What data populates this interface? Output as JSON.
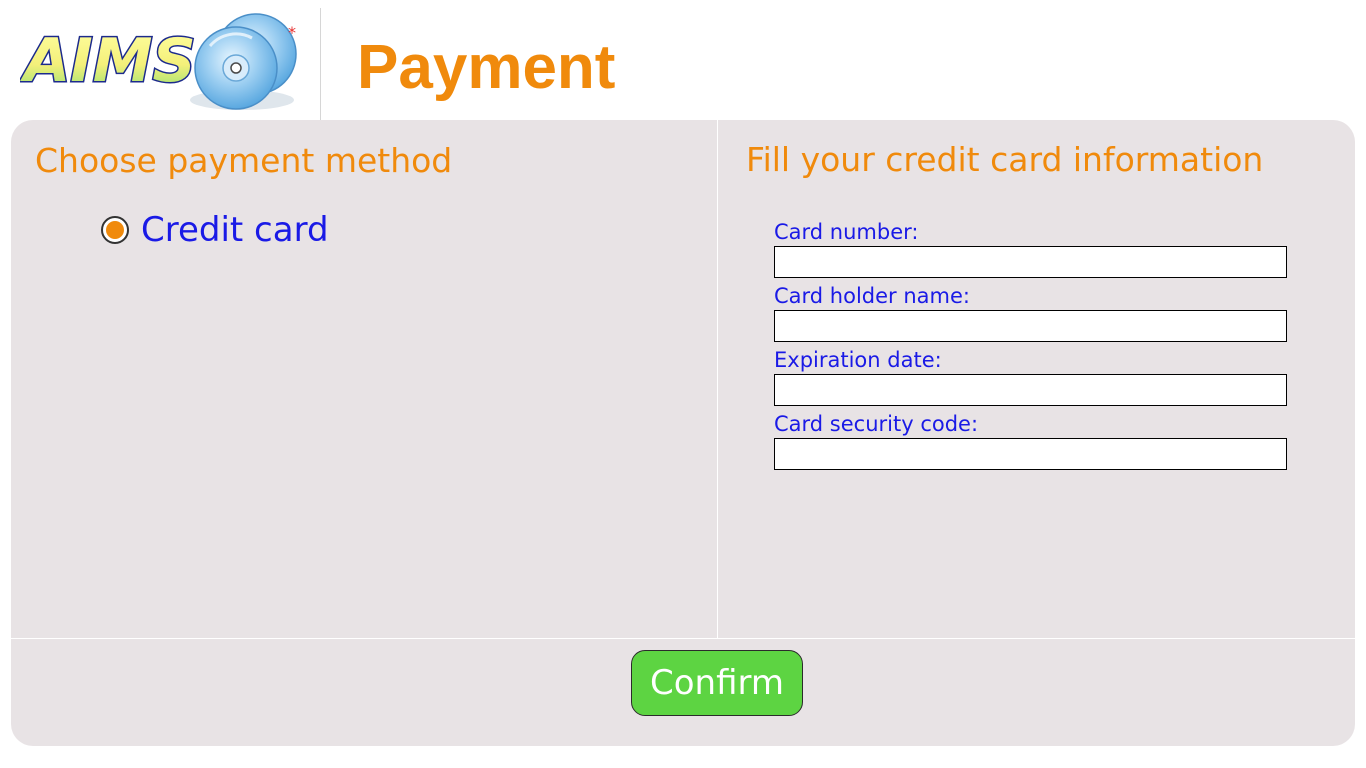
{
  "header": {
    "logo_text": "AIMS",
    "page_title": "Payment"
  },
  "payment_method": {
    "heading": "Choose payment method",
    "options": [
      {
        "label": "Credit card",
        "selected": true
      }
    ]
  },
  "card_form": {
    "heading": "Fill your credit card information",
    "fields": [
      {
        "label": "Card number:",
        "value": ""
      },
      {
        "label": "Card holder name:",
        "value": ""
      },
      {
        "label": "Expiration date:",
        "value": ""
      },
      {
        "label": "Card security code:",
        "value": ""
      }
    ]
  },
  "actions": {
    "confirm_label": "Confirm"
  },
  "colors": {
    "accent_orange": "#f08a0c",
    "label_blue": "#1a1ae6",
    "panel_bg": "#e8e3e5",
    "confirm_green": "#5dd442"
  },
  "icons": {
    "logo_disc": "cd-disc-icon"
  }
}
